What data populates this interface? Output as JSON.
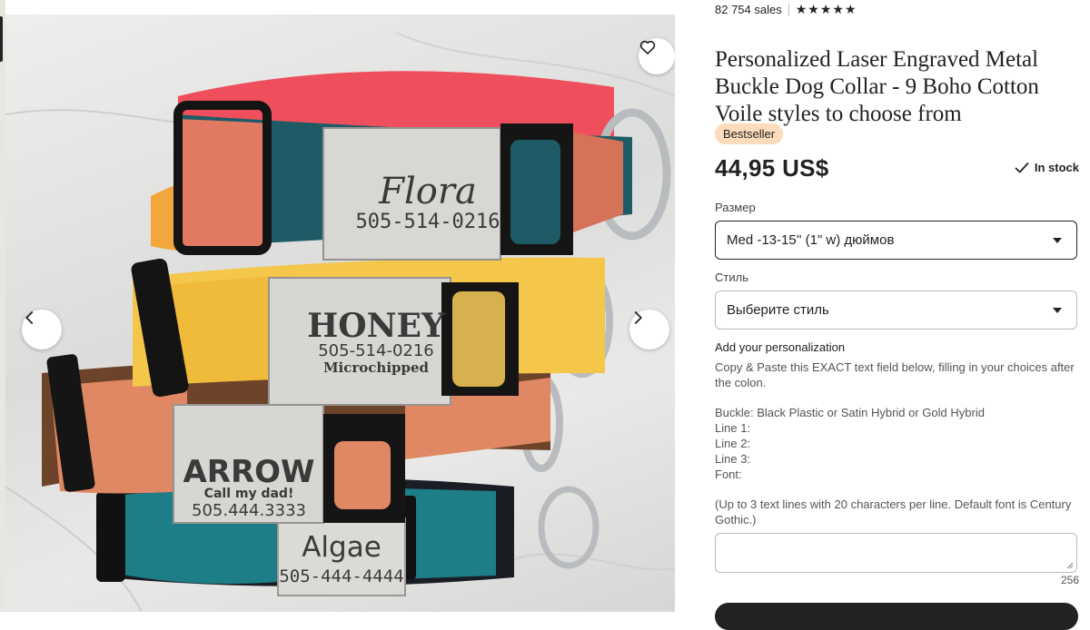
{
  "listing": {
    "sales": "82 754 sales",
    "rating_stars": "★★★★★",
    "title": "Personalized Laser Engraved Metal Buckle Dog Collar - 9 Boho Cotton Voile styles to choose from",
    "badge": "Bestseller",
    "price": "44,95 US$",
    "stock": "In stock"
  },
  "size": {
    "label": "Размер",
    "value": "Med -13-15'' (1\" w) дюймов"
  },
  "style": {
    "label": "Стиль",
    "placeholder": "Выберите стиль"
  },
  "personalization": {
    "title": "Add your personalization",
    "lines": [
      "Copy & Paste this EXACT text field below, filling in your choices after the colon.",
      "",
      "Buckle: Black Plastic or Satin Hybrid or Gold Hybrid",
      "Line 1:",
      "Line 2:",
      "Line 3:",
      "Font:",
      "",
      "(Up to 3 text lines with 20 characters per line. Default font is Century Gothic.)"
    ],
    "counter": "256"
  },
  "photo": {
    "engravings": [
      {
        "name": "Flora",
        "line2": "505-514-0216",
        "line3": ""
      },
      {
        "name": "HONEY",
        "line2": "505-514-0216",
        "line3": "Microchipped"
      },
      {
        "name": "ARROW",
        "line2": "Call my dad!",
        "line3": "505.444.3333"
      },
      {
        "name": "Algae",
        "line2": "505-444-4444",
        "line3": ""
      }
    ]
  },
  "icons": {
    "favorite": "heart-outline-icon",
    "previous": "chevron-left-icon",
    "next": "chevron-right-icon",
    "in_stock": "check-icon",
    "select_caret": "caret-down-icon"
  },
  "colors": {
    "badge_bg": "#fcdcbb",
    "text": "#222222",
    "button": "#222222"
  }
}
